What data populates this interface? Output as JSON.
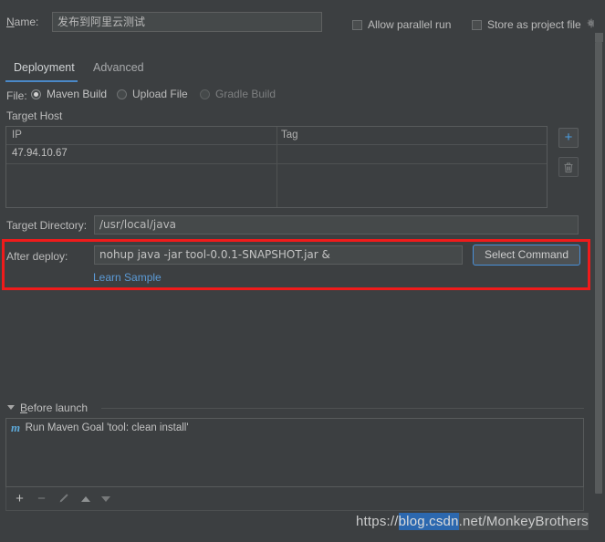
{
  "window": {
    "name_label": "Name:",
    "name_value": "发布到阿里云测试",
    "allow_parallel_run": "Allow parallel run",
    "store_as_project_file": "Store as project file",
    "gear_icon": "gear-icon"
  },
  "tabs": [
    {
      "label": "Deployment",
      "selected": true
    },
    {
      "label": "Advanced",
      "selected": false
    }
  ],
  "file_row": {
    "label": "File:",
    "options": [
      {
        "label": "Maven Build",
        "selected": true,
        "enabled": true
      },
      {
        "label": "Upload File",
        "selected": false,
        "enabled": true
      },
      {
        "label": "Gradle Build",
        "selected": false,
        "enabled": false
      }
    ]
  },
  "target_host": {
    "section_label": "Target Host",
    "columns": [
      "IP",
      "Tag"
    ],
    "rows": [
      {
        "ip": "47.94.10.67",
        "tag": ""
      }
    ],
    "add_button_icon": "plus-icon",
    "delete_button_icon": "trash-icon"
  },
  "target_directory": {
    "label": "Target Directory:",
    "value": "/usr/local/java"
  },
  "after_deploy": {
    "label": "After deploy:",
    "value": "nohup java -jar tool-0.0.1-SNAPSHOT.jar &",
    "select_command_label": "Select Command",
    "learn_sample_label": "Learn Sample",
    "highlight_color": "#ef1b1b",
    "link_color": "#5b9ad6",
    "focus_border_color": "#4a90d9"
  },
  "before_launch": {
    "title": "Before launch",
    "items": [
      {
        "icon": "maven-icon",
        "icon_glyph": "m",
        "label": "Run Maven Goal 'tool: clean install'"
      }
    ],
    "toolbar": {
      "add": "+",
      "remove": "−",
      "edit_icon": "pencil-icon",
      "move_up_icon": "triangle-up-icon",
      "move_down_icon": "triangle-down-icon"
    }
  },
  "watermark": {
    "prefix": "https://",
    "highlight": "blog.csdn",
    "suffix": ".net/MonkeyBrothers",
    "full": "https://blog.csdn.net/MonkeyBrothers"
  }
}
